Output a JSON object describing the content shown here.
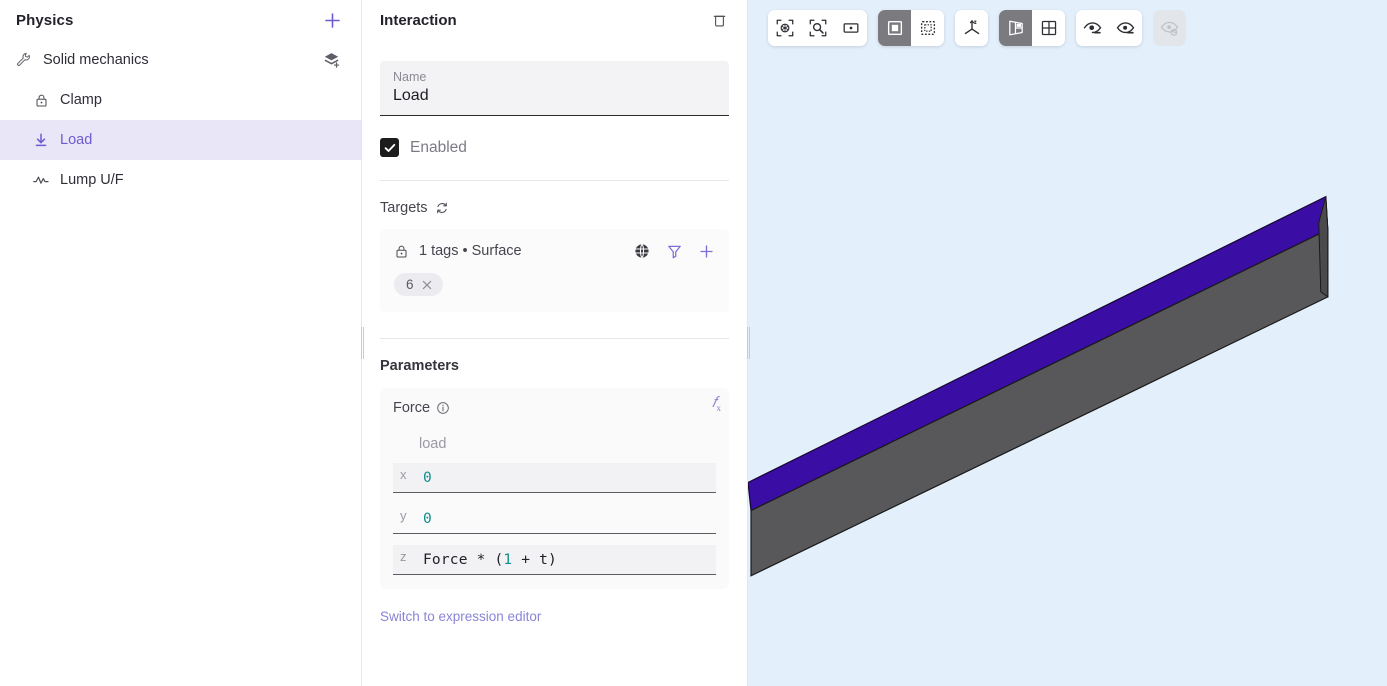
{
  "sidebar": {
    "title": "Physics",
    "add_button": "add-icon",
    "items": [
      {
        "label": "Solid mechanics",
        "icon": "wrench-icon",
        "level": 0,
        "selected": false,
        "trailing_icon": "add-layer-icon"
      },
      {
        "label": "Clamp",
        "icon": "lock-icon",
        "level": 1,
        "selected": false,
        "trailing_icon": ""
      },
      {
        "label": "Load",
        "icon": "download-arrow-icon",
        "level": 1,
        "selected": true,
        "trailing_icon": ""
      },
      {
        "label": "Lump U/F",
        "icon": "pulse-wave-icon",
        "level": 1,
        "selected": false,
        "trailing_icon": ""
      }
    ]
  },
  "inspector": {
    "title": "Interaction",
    "delete_icon": "trash-icon",
    "name_field": {
      "label": "Name",
      "value": "Load"
    },
    "enabled": {
      "label": "Enabled",
      "checked": true
    },
    "targets": {
      "title": "Targets",
      "refresh_icon": "refresh-icon",
      "summary": "1 tags • Surface",
      "lock_icon": "lock-icon",
      "actions": [
        "globe-icon",
        "filter-icon",
        "plus-icon"
      ],
      "chips": [
        {
          "label": "6",
          "remove_icon": "close-icon"
        }
      ]
    },
    "parameters": {
      "title": "Parameters",
      "fx_label": "fx",
      "force": {
        "label": "Force",
        "info_icon": "info-icon",
        "sub_name": "load",
        "components": [
          {
            "axis": "x",
            "tokens": [
              {
                "text": "0",
                "type": "num"
              }
            ]
          },
          {
            "axis": "y",
            "tokens": [
              {
                "text": "0",
                "type": "num"
              }
            ]
          },
          {
            "axis": "z",
            "tokens": [
              {
                "text": "Force * (",
                "type": "id"
              },
              {
                "text": "1",
                "type": "num"
              },
              {
                "text": " + t)",
                "type": "id"
              }
            ]
          }
        ]
      }
    },
    "switch_link": "Switch to expression editor"
  },
  "viewport": {
    "background_color": "#e3f0fb",
    "toolbar": {
      "groups": [
        {
          "name": "view-fit-group",
          "buttons": [
            {
              "name": "fit-all-icon",
              "state": "normal"
            },
            {
              "name": "zoom-selection-icon",
              "state": "normal"
            },
            {
              "name": "zoom-window-icon",
              "state": "normal"
            }
          ]
        },
        {
          "name": "selection-mode-group",
          "buttons": [
            {
              "name": "select-single-icon",
              "state": "active"
            },
            {
              "name": "select-box-icon",
              "state": "normal"
            }
          ]
        },
        {
          "name": "axis-group",
          "buttons": [
            {
              "name": "axes-triad-icon",
              "state": "normal"
            }
          ]
        },
        {
          "name": "display-mode-group",
          "buttons": [
            {
              "name": "surface-shaded-icon",
              "state": "active"
            },
            {
              "name": "grid-mesh-icon",
              "state": "normal"
            }
          ]
        },
        {
          "name": "visibility-group",
          "buttons": [
            {
              "name": "hide-element-icon",
              "state": "normal"
            },
            {
              "name": "show-element-icon",
              "state": "normal"
            }
          ]
        },
        {
          "name": "reset-visibility-group",
          "buttons": [
            {
              "name": "reset-visibility-icon",
              "state": "disabled"
            }
          ]
        }
      ]
    },
    "model": {
      "name": "cantilever-beam",
      "top_face_color": "#3a0da4",
      "side_face_color": "#58585a",
      "front_face_color": "#4a4a4c",
      "edge_color": "#1a1a1a"
    }
  },
  "colors": {
    "accent": "#6d5cd0",
    "selection_bg": "#e9e6f8",
    "panel_border": "#e6e6e9",
    "token_number": "#0f8e8e",
    "viewport_bg": "#e3f0fb"
  }
}
